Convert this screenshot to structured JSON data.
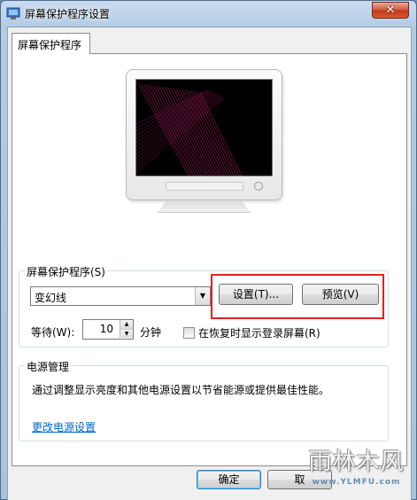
{
  "window": {
    "title": "屏幕保护程序设置",
    "close_label": "✕"
  },
  "tab": {
    "label": "屏幕保护程序"
  },
  "screensaver": {
    "group_label": "屏幕保护程序(S)",
    "selected": "变幻线",
    "settings_button": "设置(T)...",
    "preview_button": "预览(V)",
    "wait_label": "等待(W):",
    "wait_value": "10",
    "minutes_label": "分钟",
    "resume_checkbox_label": "在恢复时显示登录屏幕(R)",
    "resume_checked": false
  },
  "power": {
    "group_label": "电源管理",
    "description": "通过调整显示亮度和其他电源设置以节省能源或提供最佳性能。",
    "link": "更改电源设置"
  },
  "footer": {
    "ok_button": "确定",
    "cancel_button": "取"
  },
  "watermark": {
    "text": "雨林木风",
    "url": "www.YLMFU.com"
  },
  "colors": {
    "highlight_box": "#d9261c",
    "link": "#0066cc",
    "screen_lines": "#c2186b"
  }
}
